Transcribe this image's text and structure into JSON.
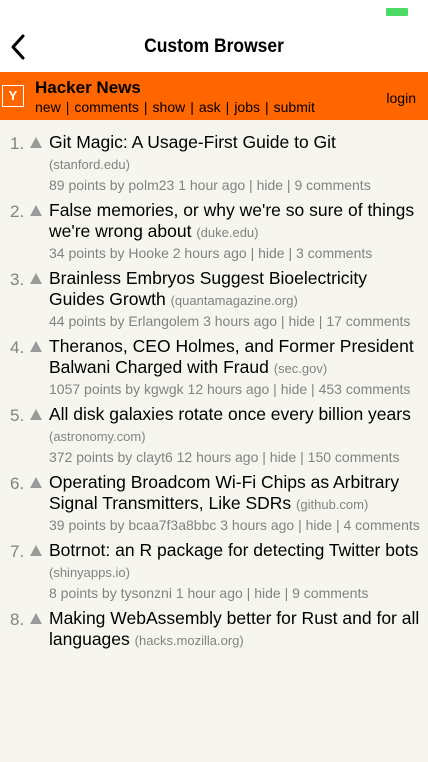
{
  "browser": {
    "title": "Custom Browser"
  },
  "hn": {
    "logo": "Y",
    "brand": "Hacker News",
    "nav": [
      "new",
      "comments",
      "show",
      "ask",
      "jobs",
      "submit"
    ],
    "login": "login"
  },
  "stories": [
    {
      "rank": "1.",
      "title": "Git Magic: A Usage-First Guide to Git",
      "domain": "(stanford.edu)",
      "byline": "89 points by polm23 1 hour ago | ",
      "hide": "hide",
      "sep": " | ",
      "comments": "9 comments"
    },
    {
      "rank": "2.",
      "title": "False memories, or why we're so sure of things we're wrong about",
      "domain": "(duke.edu)",
      "byline": "34 points by Hooke 2 hours ago | ",
      "hide": "hide",
      "sep": " | ",
      "comments": "3 comments"
    },
    {
      "rank": "3.",
      "title": "Brainless Embryos Suggest Bioelectricity Guides Growth",
      "domain": "(quantamagazine.org)",
      "byline": "44 points by Erlangolem 3 hours ago | ",
      "hide": "hide",
      "sep": " | ",
      "comments": "17 comments"
    },
    {
      "rank": "4.",
      "title": "Theranos, CEO Holmes, and Former President Balwani Charged with Fraud",
      "domain": "(sec.gov)",
      "byline": "1057 points by kgwgk 12 hours ago | ",
      "hide": "hide",
      "sep": " | ",
      "comments": "453 comments"
    },
    {
      "rank": "5.",
      "title": "All disk galaxies rotate once every billion years",
      "domain": "(astronomy.com)",
      "byline": "372 points by clayt6 12 hours ago | ",
      "hide": "hide",
      "sep": " | ",
      "comments": "150 comments"
    },
    {
      "rank": "6.",
      "title": "Operating Broadcom Wi-Fi Chips as Arbitrary Signal Transmitters, Like SDRs",
      "domain": "(github.com)",
      "byline": "39 points by bcaa7f3a8bbc 3 hours ago | ",
      "hide": "hide",
      "sep": " | ",
      "comments": "4 comments"
    },
    {
      "rank": "7.",
      "title": "Botrnot: an R package for detecting Twitter bots",
      "domain": "(shinyapps.io)",
      "byline": "8 points by tysonzni 1 hour ago | ",
      "hide": "hide",
      "sep": " | ",
      "comments": "9 comments"
    },
    {
      "rank": "8.",
      "title": "Making WebAssembly better for Rust and for all languages",
      "domain": "(hacks.mozilla.org)",
      "byline": "",
      "hide": "",
      "sep": "",
      "comments": ""
    }
  ]
}
